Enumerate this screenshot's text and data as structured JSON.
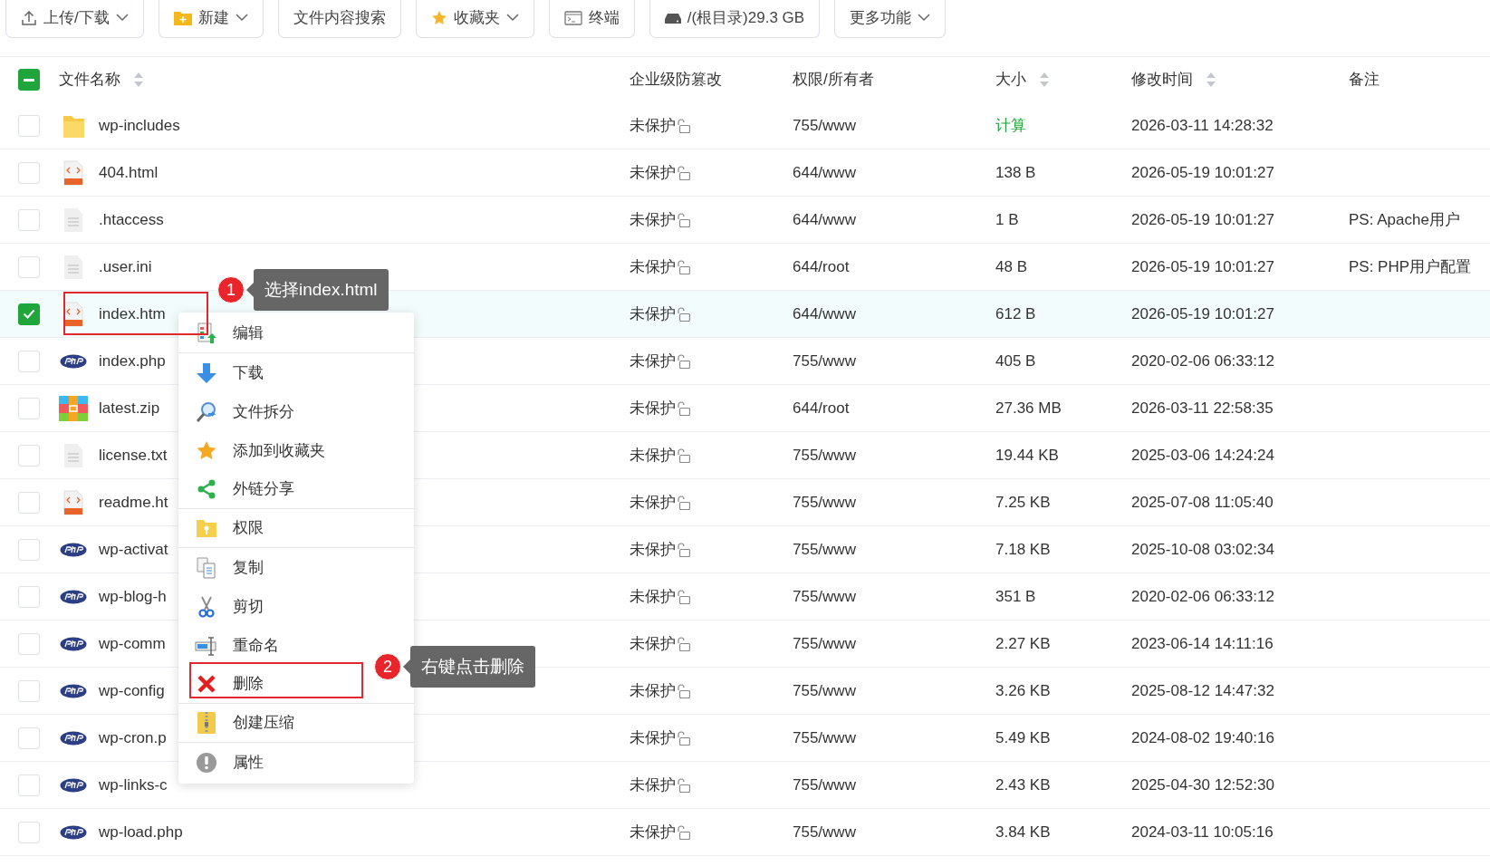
{
  "toolbar": [
    {
      "label": "上传/下载",
      "kind": "upload",
      "dropdown": true
    },
    {
      "label": "新建",
      "kind": "new",
      "dropdown": true
    },
    {
      "label": "文件内容搜索",
      "kind": "plain",
      "dropdown": false
    },
    {
      "label": "收藏夹",
      "kind": "favorites",
      "dropdown": true
    },
    {
      "label": "终端",
      "kind": "terminal",
      "dropdown": false
    },
    {
      "label": "/(根目录)29.3 GB",
      "kind": "disk",
      "dropdown": false
    },
    {
      "label": "更多功能",
      "kind": "plain",
      "dropdown": true
    }
  ],
  "table": {
    "select_all": {
      "indeterminate": true
    },
    "columns": [
      {
        "label": "文件名称",
        "sortable": true
      },
      {
        "label": "企业级防篡改",
        "sortable": false
      },
      {
        "label": "权限/所有者",
        "sortable": false
      },
      {
        "label": "大小",
        "sortable": true
      },
      {
        "label": "修改时间",
        "sortable": true
      },
      {
        "label": "备注",
        "sortable": false
      }
    ],
    "rows": [
      {
        "kind": "folder",
        "name": "wp-includes",
        "protection": "未保护",
        "permission": "755/www",
        "size": "计算",
        "size_action": true,
        "modified": "2026-03-11 14:28:32",
        "selected": false,
        "outlined": false
      },
      {
        "kind": "html",
        "name": "404.html",
        "protection": "未保护",
        "permission": "644/www",
        "size": "138 B",
        "size_action": false,
        "modified": "2026-05-19 10:01:27",
        "selected": false,
        "outlined": false
      },
      {
        "kind": "text",
        "name": ".htaccess",
        "protection": "未保护",
        "permission": "644/www",
        "size": "1 B",
        "size_action": false,
        "modified": "2026-05-19 10:01:27",
        "note": "PS: Apache用户",
        "selected": false,
        "outlined": false
      },
      {
        "kind": "text",
        "name": ".user.ini",
        "protection": "未保护",
        "permission": "644/root",
        "size": "48 B",
        "size_action": false,
        "modified": "2026-05-19 10:01:27",
        "note": "PS: PHP用户配置",
        "selected": false,
        "outlined": false
      },
      {
        "kind": "html",
        "name": "index.htm",
        "protection": "未保护",
        "permission": "644/www",
        "size": "612 B",
        "size_action": false,
        "modified": "2026-05-19 10:01:27",
        "selected": true,
        "outlined": true
      },
      {
        "kind": "php",
        "name": "index.php",
        "protection": "未保护",
        "permission": "755/www",
        "size": "405 B",
        "size_action": false,
        "modified": "2020-02-06 06:33:12",
        "selected": false,
        "outlined": false
      },
      {
        "kind": "zip",
        "name": "latest.zip",
        "protection": "未保护",
        "permission": "644/root",
        "size": "27.36 MB",
        "size_action": false,
        "modified": "2026-03-11 22:58:35",
        "selected": false,
        "outlined": false
      },
      {
        "kind": "text",
        "name": "license.txt",
        "protection": "未保护",
        "permission": "755/www",
        "size": "19.44 KB",
        "size_action": false,
        "modified": "2025-03-06 14:24:24",
        "selected": false,
        "outlined": false
      },
      {
        "kind": "html",
        "name": "readme.ht",
        "protection": "未保护",
        "permission": "755/www",
        "size": "7.25 KB",
        "size_action": false,
        "modified": "2025-07-08 11:05:40",
        "selected": false,
        "outlined": false
      },
      {
        "kind": "php",
        "name": "wp-activat",
        "protection": "未保护",
        "permission": "755/www",
        "size": "7.18 KB",
        "size_action": false,
        "modified": "2025-10-08 03:02:34",
        "selected": false,
        "outlined": false
      },
      {
        "kind": "php",
        "name": "wp-blog-h",
        "protection": "未保护",
        "permission": "755/www",
        "size": "351 B",
        "size_action": false,
        "modified": "2020-02-06 06:33:12",
        "selected": false,
        "outlined": false
      },
      {
        "kind": "php",
        "name": "wp-comm",
        "protection": "未保护",
        "permission": "755/www",
        "size": "2.27 KB",
        "size_action": false,
        "modified": "2023-06-14 14:11:16",
        "selected": false,
        "outlined": false
      },
      {
        "kind": "php",
        "name": "wp-config",
        "protection": "未保护",
        "permission": "755/www",
        "size": "3.26 KB",
        "size_action": false,
        "modified": "2025-08-12 14:47:32",
        "selected": false,
        "outlined": false
      },
      {
        "kind": "php",
        "name": "wp-cron.p",
        "protection": "未保护",
        "permission": "755/www",
        "size": "5.49 KB",
        "size_action": false,
        "modified": "2024-08-02 19:40:16",
        "selected": false,
        "outlined": false
      },
      {
        "kind": "php",
        "name": "wp-links-c",
        "protection": "未保护",
        "permission": "755/www",
        "size": "2.43 KB",
        "size_action": false,
        "modified": "2025-04-30 12:52:30",
        "selected": false,
        "outlined": false
      },
      {
        "kind": "php",
        "name": "wp-load.php",
        "protection": "未保护",
        "permission": "755/www",
        "size": "3.84 KB",
        "size_action": false,
        "modified": "2024-03-11 10:05:16",
        "selected": false,
        "outlined": false
      }
    ]
  },
  "context_menu": {
    "items": [
      {
        "kind": "edit",
        "label": "编辑",
        "divider_after": true,
        "outlined": false
      },
      {
        "kind": "download",
        "label": "下载",
        "divider_after": false,
        "outlined": false
      },
      {
        "kind": "split",
        "label": "文件拆分",
        "divider_after": false,
        "outlined": false
      },
      {
        "kind": "favorite",
        "label": "添加到收藏夹",
        "divider_after": false,
        "outlined": false
      },
      {
        "kind": "share",
        "label": "外链分享",
        "divider_after": true,
        "outlined": false
      },
      {
        "kind": "permission",
        "label": "权限",
        "divider_after": true,
        "outlined": false
      },
      {
        "kind": "copy",
        "label": "复制",
        "divider_after": false,
        "outlined": false
      },
      {
        "kind": "cut",
        "label": "剪切",
        "divider_after": false,
        "outlined": false
      },
      {
        "kind": "rename",
        "label": "重命名",
        "divider_after": false,
        "outlined": false
      },
      {
        "kind": "delete",
        "label": "删除",
        "divider_after": true,
        "outlined": true
      },
      {
        "kind": "compress",
        "label": "创建压缩",
        "divider_after": true,
        "outlined": false
      },
      {
        "kind": "properties",
        "label": "属性",
        "divider_after": false,
        "outlined": false
      }
    ]
  },
  "callouts": [
    {
      "number": "1",
      "text": "选择index.html"
    },
    {
      "number": "2",
      "text": "右键点击删除"
    }
  ]
}
